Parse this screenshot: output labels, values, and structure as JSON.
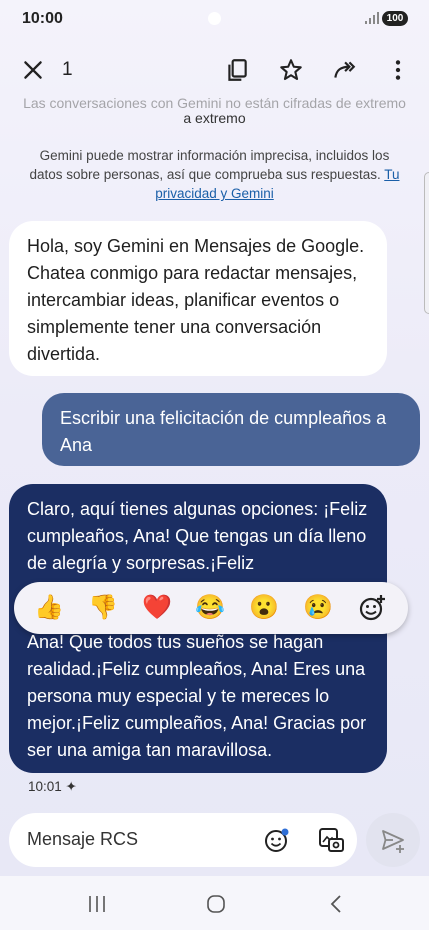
{
  "status_bar": {
    "time": "10:00",
    "battery": "100"
  },
  "top_bar": {
    "selected_count": "1"
  },
  "info": {
    "e2e_text_hidden": "Las conversaciones con Gemini no están cifradas de extremo",
    "e2e_text": "a extremo",
    "disclaimer": "Gemini puede mostrar información imprecisa, incluidos los datos sobre personas, así que comprueba sus respuestas.",
    "disclaimer_link": "Tu privacidad y Gemini"
  },
  "messages": {
    "gemini_intro": "Hola, soy Gemini en Mensajes de Google. Chatea conmigo para redactar mensajes, intercambiar ideas, planificar eventos o simplemente tener una conversación divertida.",
    "user_request": "Escribir una felicitación de cumpleaños a Ana",
    "reply_top": "Claro, aquí tienes algunas opciones: ¡Feliz cumpleaños, Ana! Que tengas un día lleno de alegría y sorpresas.¡Feliz",
    "reply_bottom": "Ana! Que todos tus sueños se hagan realidad.¡Feliz cumpleaños, Ana! Eres una persona muy especial y te mereces lo mejor.¡Feliz cumpleaños, Ana! Gracias por ser una amiga tan maravillosa.",
    "time": "10:01 ✦"
  },
  "reactions": [
    "👍",
    "👎",
    "❤️",
    "😂",
    "😮",
    "😢"
  ],
  "composer": {
    "placeholder": "Mensaje RCS"
  },
  "colors": {
    "user_bubble": "#4a6496",
    "reply_bubble": "#1b2e63",
    "link": "#1a5fa8"
  },
  "icons": {
    "close": "close-icon",
    "copy": "copy-icon",
    "star": "star-icon",
    "forward": "forward-icon",
    "more": "more-vert-icon",
    "add_reaction": "add-reaction-icon",
    "emoji": "emoji-icon",
    "gallery": "gallery-icon",
    "send": "send-icon",
    "nav_recents": "recents-icon",
    "nav_home": "home-icon",
    "nav_back": "back-icon"
  }
}
